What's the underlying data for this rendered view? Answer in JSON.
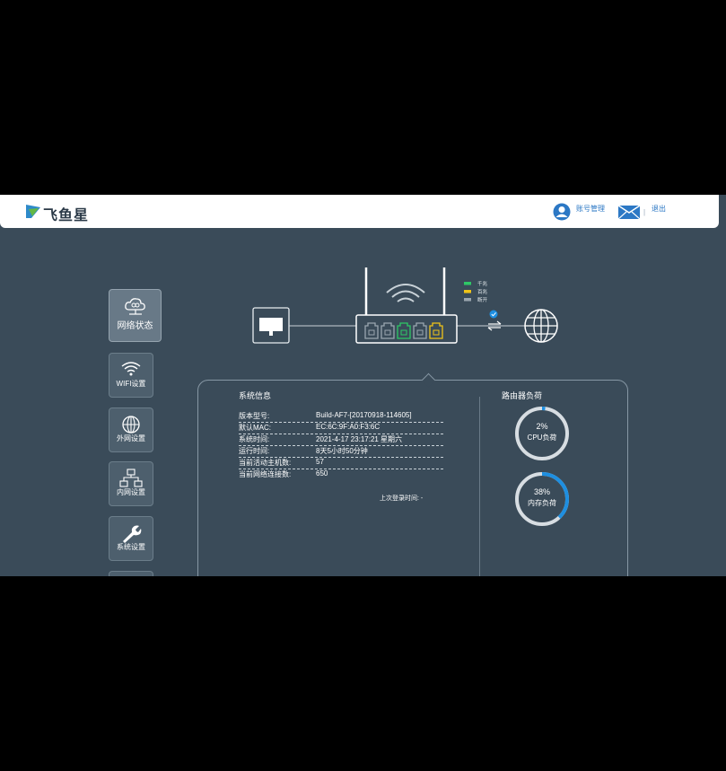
{
  "header": {
    "logo_text": "飞鱼星",
    "user_label": "账号管理",
    "logout_label": "退出",
    "separator": "|"
  },
  "sidebar": {
    "items": [
      {
        "label": "网络状态",
        "icon": "network-cloud-icon",
        "active": true
      },
      {
        "label": "WIFI设置",
        "icon": "wifi-icon",
        "active": false
      },
      {
        "label": "外网设置",
        "icon": "globe-icon",
        "active": false
      },
      {
        "label": "内网设置",
        "icon": "lan-topology-icon",
        "active": false
      },
      {
        "label": "系统设置",
        "icon": "wrench-icon",
        "active": false
      }
    ]
  },
  "diagram": {
    "legend": [
      {
        "label": "千兆",
        "color": "#2ec866"
      },
      {
        "label": "百兆",
        "color": "#f0c419"
      },
      {
        "label": "断开",
        "color": "#9aa6b0"
      }
    ],
    "port_colors": [
      "#9aa6b0",
      "#9aa6b0",
      "#2ec866",
      "#9aa6b0",
      "#f0c419"
    ]
  },
  "system_info": {
    "title": "系统信息",
    "rows": [
      {
        "label": "版本型号:",
        "value": "Build-AF7-[20170918-114605]"
      },
      {
        "label": "默认MAC:",
        "value": "EC:6C:9F:A0:F3:6C"
      },
      {
        "label": "系统时间:",
        "value": "2021-4-17 23:17:21 星期六"
      },
      {
        "label": "运行时间:",
        "value": "8天5小时50分钟"
      },
      {
        "label": "当前活动主机数:",
        "value": "57"
      },
      {
        "label": "当前网络连接数:",
        "value": "650"
      }
    ],
    "last_login": "上次登录时间: -"
  },
  "router_load": {
    "title": "路由器负荷",
    "gauges": [
      {
        "percent_text": "2%",
        "label": "CPU负荷",
        "value": 0.02
      },
      {
        "percent_text": "38%",
        "label": "内存负荷",
        "value": 0.38
      }
    ],
    "colors": {
      "track": "#d7dde2",
      "fill": "#1e8fe1"
    }
  }
}
